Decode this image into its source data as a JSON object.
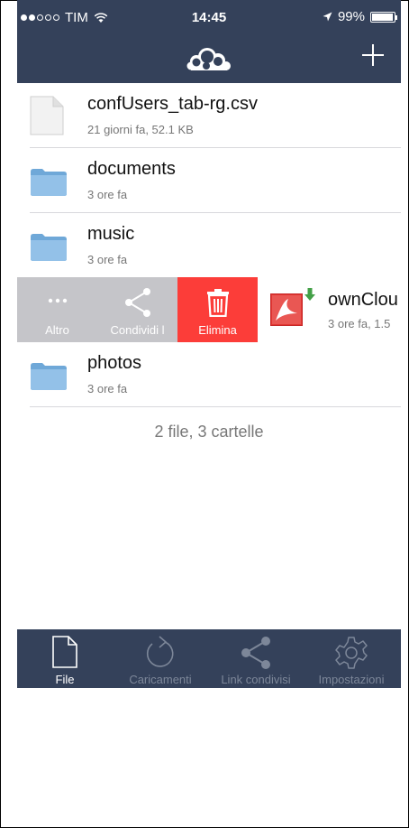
{
  "status_bar": {
    "carrier": "TIM",
    "time": "14:45",
    "battery": "99%"
  },
  "header": {
    "logo_icon": "owncloud-logo-icon",
    "add_icon": "plus-icon"
  },
  "files": [
    {
      "name": "confUsers_tab-rg.csv",
      "meta": "21 giorni fa, 52.1 KB",
      "icon": "document-icon"
    },
    {
      "name": "documents",
      "meta": "3 ore fa",
      "icon": "folder-icon"
    },
    {
      "name": "music",
      "meta": "3 ore fa",
      "icon": "folder-icon"
    },
    {
      "name": "photos",
      "meta": "3 ore fa",
      "icon": "folder-icon"
    }
  ],
  "swiped_file": {
    "name": "ownClou",
    "meta": "3 ore fa, 1.5",
    "icon": "pdf-icon",
    "badge_icon": "download-arrow-icon"
  },
  "swipe_actions": {
    "more": "Altro",
    "share": "Condividi l",
    "delete": "Elimina"
  },
  "summary": "2 file, 3 cartelle",
  "tabs": [
    {
      "label": "File",
      "icon": "file-icon",
      "active": true
    },
    {
      "label": "Caricamenti",
      "icon": "refresh-icon",
      "active": false
    },
    {
      "label": "Link condivisi",
      "icon": "share-icon",
      "active": false
    },
    {
      "label": "Impostazioni",
      "icon": "gear-icon",
      "active": false
    }
  ],
  "colors": {
    "header_bg": "#34415a",
    "delete_red": "#fc3d39",
    "action_gray": "#c5c5c9",
    "tab_inactive": "#7d8799"
  }
}
